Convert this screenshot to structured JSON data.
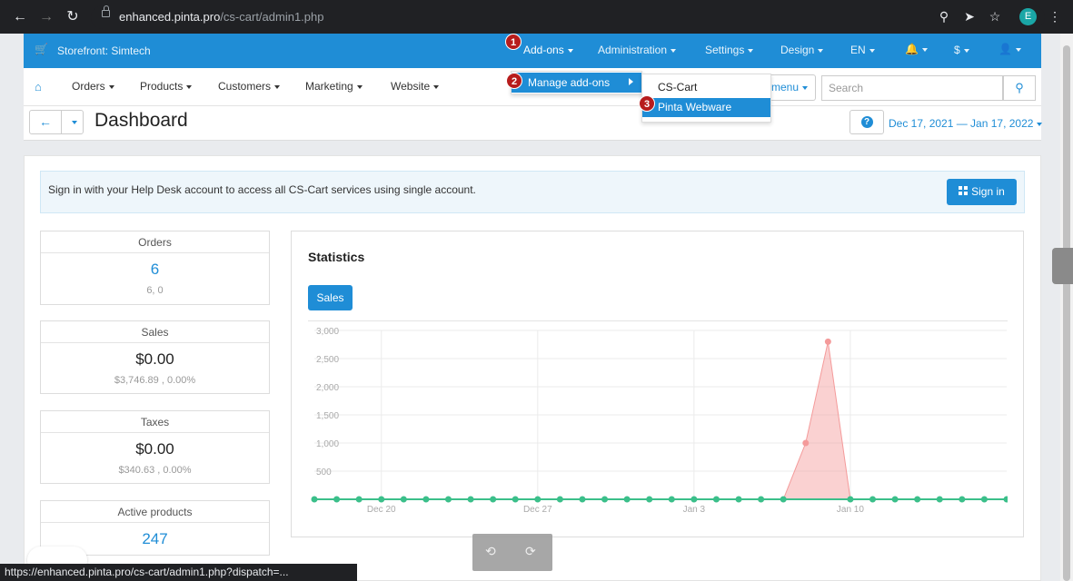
{
  "browser": {
    "url_host": "enhanced.pinta.pro",
    "url_path": "/cs-cart/admin1.php",
    "profile_initial": "E",
    "status_url": "https://enhanced.pinta.pro/cs-cart/admin1.php?dispatch=..."
  },
  "topbar": {
    "storefront": "Storefront: Simtech",
    "menu": [
      "Add-ons",
      "Administration",
      "Settings",
      "Design",
      "EN"
    ],
    "currency": "$"
  },
  "subnav": {
    "items": [
      "Orders",
      "Products",
      "Customers",
      "Marketing",
      "Website"
    ],
    "hidden_menu_tail": "menu",
    "search_placeholder": "Search"
  },
  "titlebar": {
    "title": "Dashboard",
    "date_range": "Dec 17, 2021 — Jan 17, 2022"
  },
  "alert": {
    "text": "Sign in with your Help Desk account to access all CS-Cart services using single account.",
    "button": "Sign in"
  },
  "cards": [
    {
      "title": "Orders",
      "value": "6",
      "sub": "6, 0"
    },
    {
      "title": "Sales",
      "value": "$0.00",
      "sub": "$3,746.89 , 0.00%"
    },
    {
      "title": "Taxes",
      "value": "$0.00",
      "sub": "$340.63 , 0.00%"
    },
    {
      "title": "Active products",
      "value": "247",
      "sub": ""
    }
  ],
  "statistics": {
    "title": "Statistics",
    "tab": "Sales"
  },
  "dropdown": {
    "manage": "Manage add-ons",
    "sub": [
      "CS-Cart",
      "Pinta Webware"
    ]
  },
  "badges": [
    "1",
    "2",
    "3"
  ],
  "colors": {
    "brand": "#1f8dd6",
    "badge": "#b71c1c",
    "series_zero": "#3bbf8a",
    "series_sales": "#f49a9a"
  },
  "chart_data": {
    "type": "area",
    "yticks": [
      "3,000",
      "2,500",
      "2,000",
      "1,500",
      "1,000",
      "500"
    ],
    "xtick_labels": [
      "Dec 20",
      "Dec 27",
      "Jan 3",
      "Jan 10"
    ],
    "ylim": [
      0,
      3000
    ],
    "series": [
      {
        "x": [
          "Dec 17",
          "Dec 18",
          "Dec 19",
          "Dec 20",
          "Dec 21",
          "Dec 22",
          "Dec 23",
          "Dec 24",
          "Dec 25",
          "Dec 26",
          "Dec 27",
          "Dec 28",
          "Dec 29",
          "Dec 30",
          "Dec 31",
          "Jan 1",
          "Jan 2",
          "Jan 3",
          "Jan 4",
          "Jan 5",
          "Jan 6",
          "Jan 7",
          "Jan 8",
          "Jan 9",
          "Jan 10",
          "Jan 11",
          "Jan 12",
          "Jan 13",
          "Jan 14",
          "Jan 15",
          "Jan 16",
          "Jan 17"
        ],
        "values": [
          0,
          0,
          0,
          0,
          0,
          0,
          0,
          0,
          0,
          0,
          0,
          0,
          0,
          0,
          0,
          0,
          0,
          0,
          0,
          0,
          0,
          0,
          1000,
          2800,
          0,
          0,
          0,
          0,
          0,
          0,
          0,
          0
        ]
      }
    ]
  }
}
